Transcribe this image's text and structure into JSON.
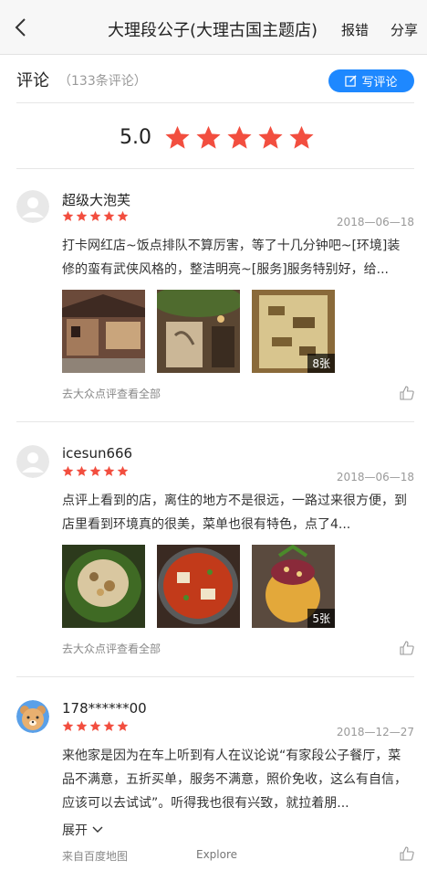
{
  "header": {
    "title": "大理段公子(大理古国主题店)",
    "report_label": "报错",
    "share_label": "分享"
  },
  "reviews_section": {
    "title": "评论",
    "count_text": "（133条评论）",
    "write_label": "写评论",
    "overall_rating": "5.0",
    "overall_stars": 5
  },
  "colors": {
    "accent": "#1e88ff",
    "star": "#f24e3f"
  },
  "reviews": [
    {
      "username": "超级大泡芙",
      "stars": 5,
      "date": "2018—06—18",
      "text": "打卡网红店~饭点排队不算厉害，等了十几分钟吧~[环境]装修的蛮有武侠风格的，整洁明亮~[服务]服务特别好，给...",
      "photo_count": "8张",
      "source": "去大众点评查看全部",
      "avatar_icon": "default-avatar-icon"
    },
    {
      "username": "icesun666",
      "stars": 5,
      "date": "2018—06—18",
      "text": "点评上看到的店，离住的地方不是很远，一路过来很方便，到店里看到环境真的很美，菜单也很有特色，点了4...",
      "photo_count": "5张",
      "source": "去大众点评查看全部",
      "avatar_icon": "default-avatar-icon"
    },
    {
      "username": "178******00",
      "stars": 5,
      "date": "2018—12—27",
      "text": "来他家是因为在车上听到有人在议论说“有家段公子餐厅，菜品不满意，五折买单，服务不满意，照价免收，这么有自信，应该可以去试试”。听得我也很有兴致，就拉着朋...",
      "expand_label": "展开",
      "source": "来自百度地图",
      "explore_label": "Explore",
      "avatar_icon": "bear-avatar-icon"
    }
  ]
}
